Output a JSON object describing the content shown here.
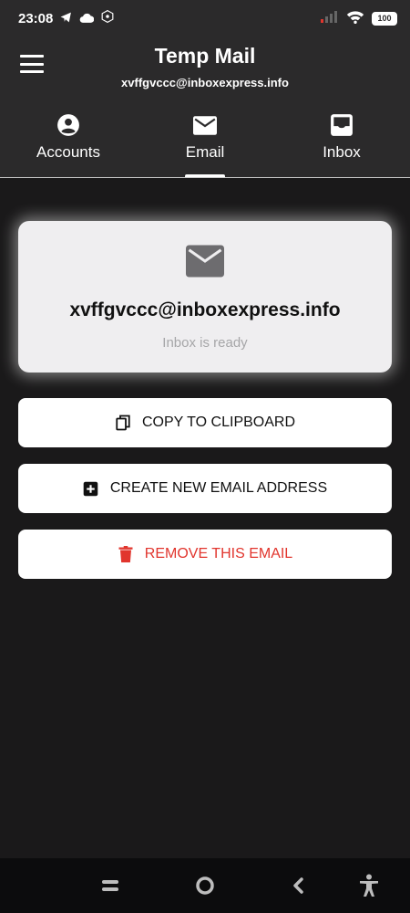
{
  "status_bar": {
    "time": "23:08",
    "battery": "100"
  },
  "app_bar": {
    "title": "Temp Mail",
    "subtitle": "xvffgvccc@inboxexpress.info"
  },
  "tabs": [
    {
      "label": "Accounts",
      "icon": "account-circle-icon",
      "active": false
    },
    {
      "label": "Email",
      "icon": "mail-icon",
      "active": true
    },
    {
      "label": "Inbox",
      "icon": "inbox-icon",
      "active": false
    }
  ],
  "card": {
    "email": "xvffgvccc@inboxexpress.info",
    "status": "Inbox is ready",
    "icon": "mail-icon"
  },
  "actions": {
    "copy_label": "COPY TO CLIPBOARD",
    "create_label": "CREATE NEW EMAIL ADDRESS",
    "remove_label": "REMOVE THIS EMAIL"
  },
  "colors": {
    "background": "#1a191a",
    "app_bar": "#2b2a2b",
    "card": "#efeef0",
    "danger": "#e1352d",
    "muted_text": "#a6a6a8"
  }
}
